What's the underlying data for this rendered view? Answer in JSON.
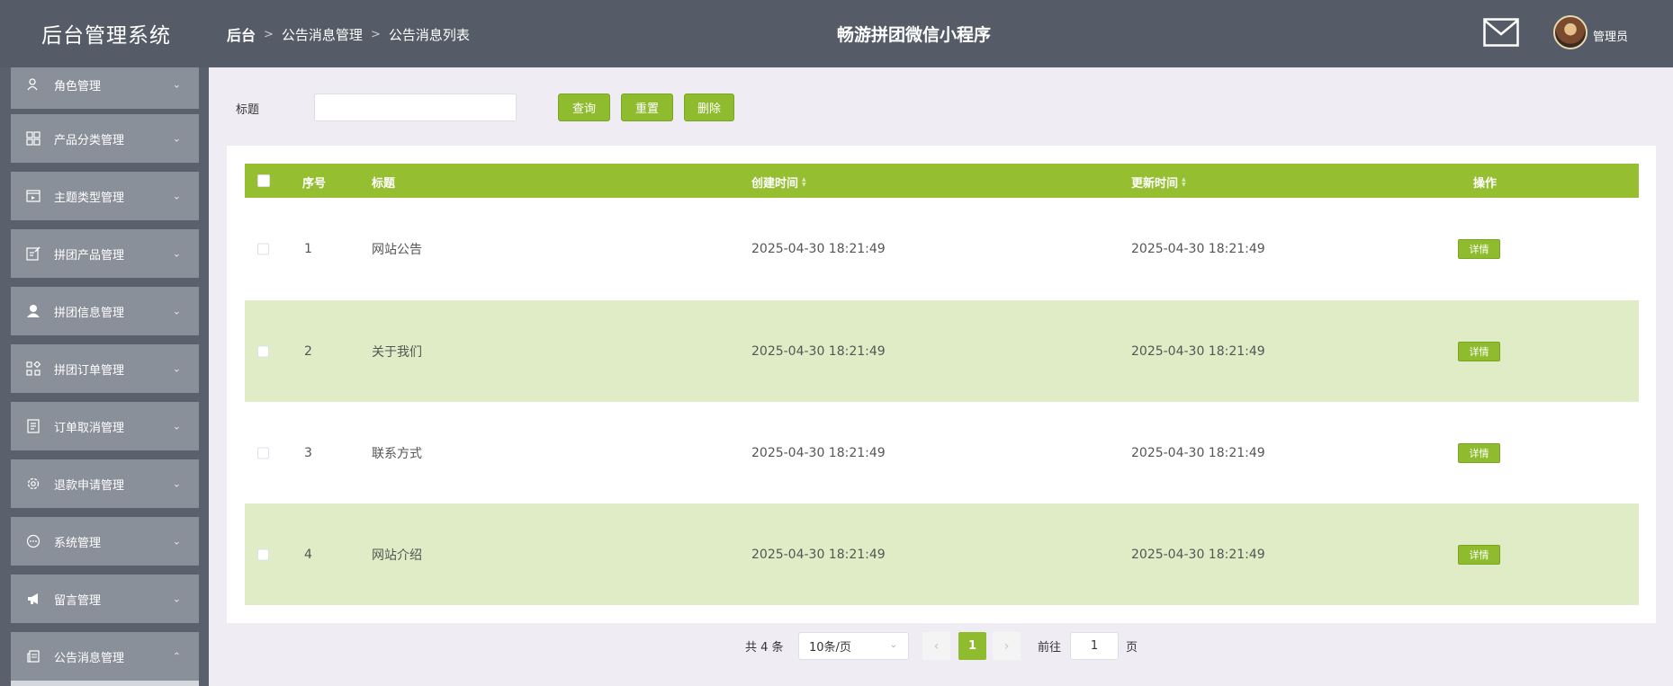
{
  "header": {
    "app_title": "后台管理系统",
    "breadcrumb": [
      "后台",
      "公告消息管理",
      "公告消息列表"
    ],
    "breadcrumb_sep": ">",
    "center_title": "畅游拼团微信小程序",
    "admin_name": "管理员"
  },
  "sidebar": {
    "chevron_down": "⌄",
    "chevron_up": "⌃",
    "items": [
      {
        "label": "角色管理",
        "icon": "user-role-icon",
        "expanded": false
      },
      {
        "label": "产品分类管理",
        "icon": "grid-icon",
        "expanded": false
      },
      {
        "label": "主题类型管理",
        "icon": "screen-icon",
        "expanded": false
      },
      {
        "label": "拼团产品管理",
        "icon": "edit-doc-icon",
        "expanded": false
      },
      {
        "label": "拼团信息管理",
        "icon": "person-icon",
        "expanded": false
      },
      {
        "label": "拼团订单管理",
        "icon": "apps-icon",
        "expanded": false
      },
      {
        "label": "订单取消管理",
        "icon": "receipt-icon",
        "expanded": false
      },
      {
        "label": "退款申请管理",
        "icon": "gear-icon",
        "expanded": false
      },
      {
        "label": "系统管理",
        "icon": "chat-icon",
        "expanded": false
      },
      {
        "label": "留言管理",
        "icon": "megaphone-icon",
        "expanded": false
      },
      {
        "label": "公告消息管理",
        "icon": "news-icon",
        "expanded": true
      }
    ]
  },
  "search": {
    "label": "标题",
    "value": "",
    "placeholder": "",
    "query_label": "查询",
    "reset_label": "重置",
    "delete_label": "删除"
  },
  "table": {
    "columns": [
      "序号",
      "标题",
      "创建时间",
      "更新时间",
      "操作"
    ],
    "detail_label": "详情",
    "rows": [
      {
        "index": "1",
        "title": "网站公告",
        "created": "2025-04-30 18:21:49",
        "updated": "2025-04-30 18:21:49"
      },
      {
        "index": "2",
        "title": "关于我们",
        "created": "2025-04-30 18:21:49",
        "updated": "2025-04-30 18:21:49"
      },
      {
        "index": "3",
        "title": "联系方式",
        "created": "2025-04-30 18:21:49",
        "updated": "2025-04-30 18:21:49"
      },
      {
        "index": "4",
        "title": "网站介绍",
        "created": "2025-04-30 18:21:49",
        "updated": "2025-04-30 18:21:49"
      }
    ]
  },
  "pagination": {
    "total_text": "共 4 条",
    "page_size": "10条/页",
    "prev": "‹",
    "next": "›",
    "current_page": "1",
    "goto_label": "前往",
    "goto_value": "1",
    "page_suffix": "页"
  },
  "colors": {
    "header_bg": "#565c67",
    "sidebar_item_bg": "#8a9099",
    "accent": "#8fbc2f",
    "table_head": "#95bf31",
    "alt_row": "#e0ecc6"
  }
}
